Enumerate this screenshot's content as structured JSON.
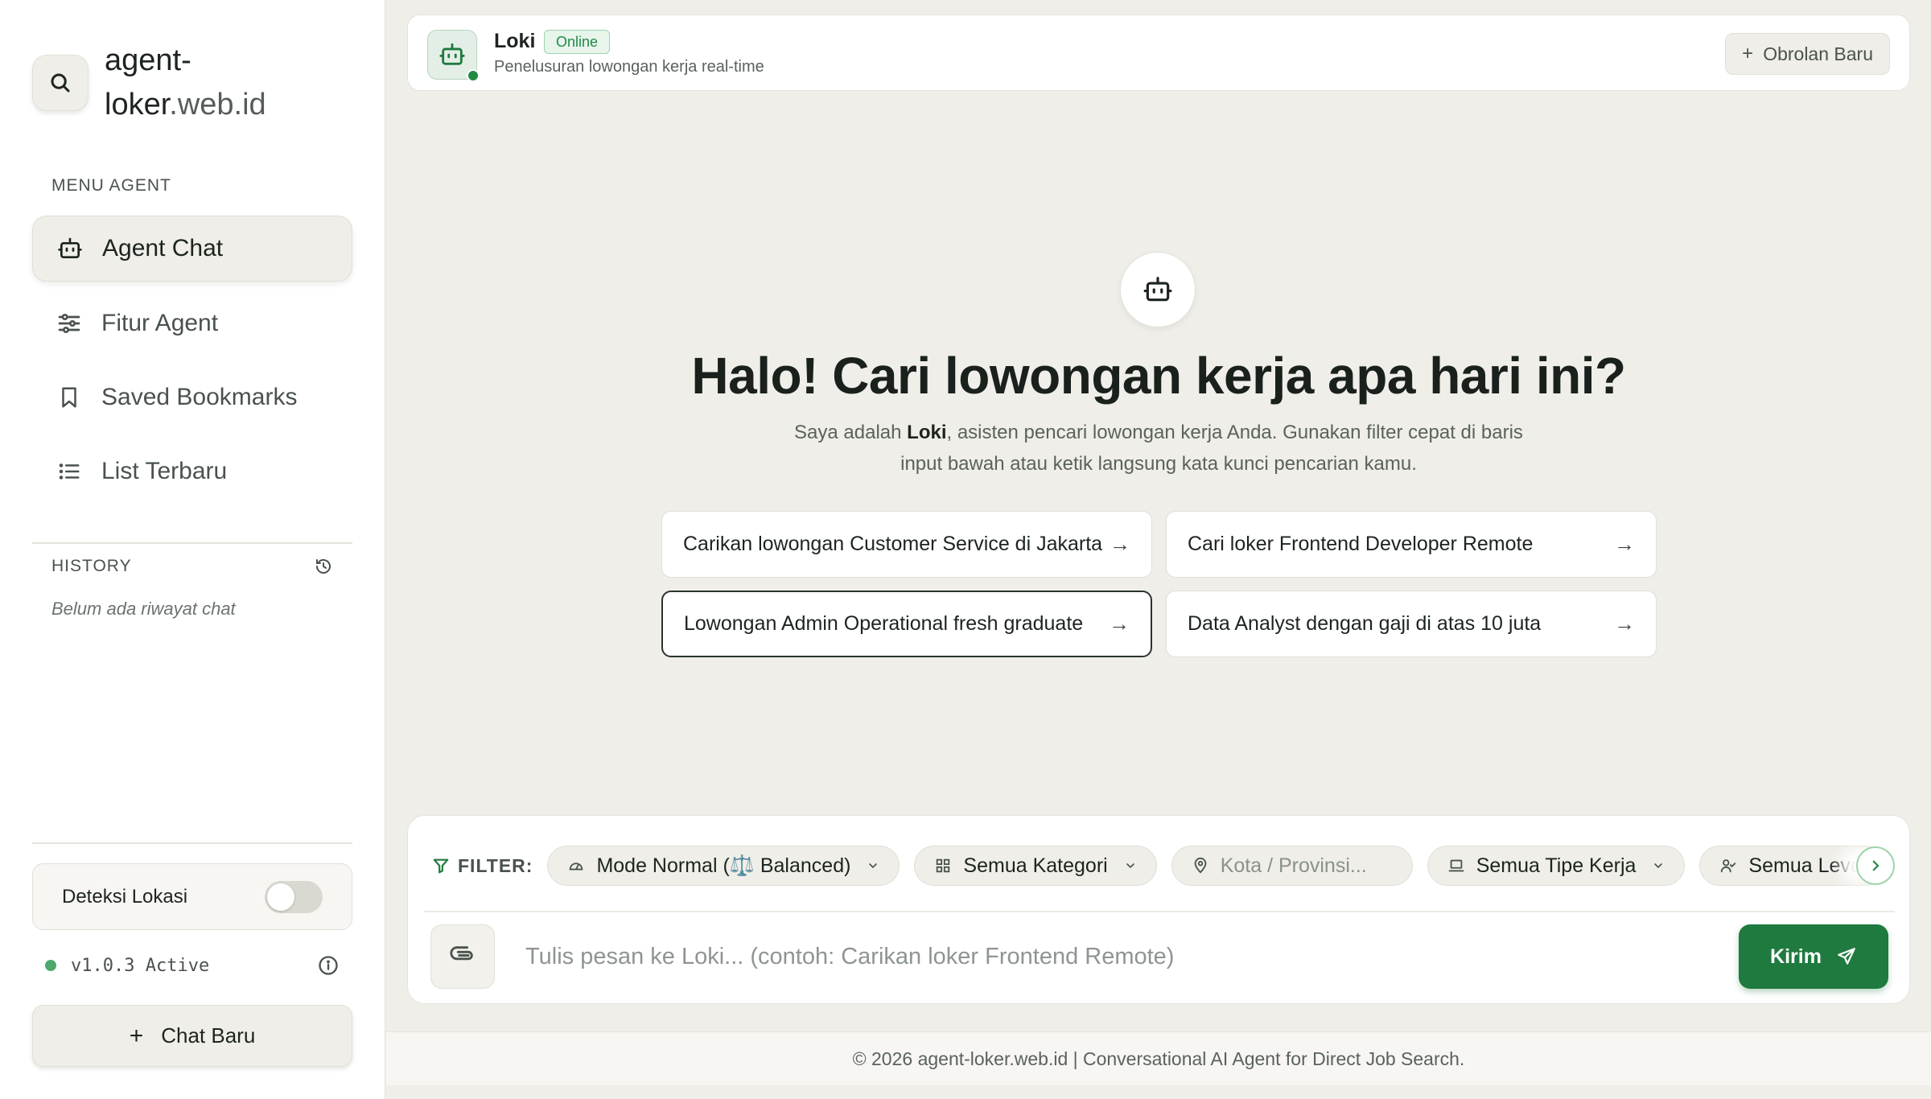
{
  "brand": {
    "name_main": "agent-loker",
    "name_suffix": ".web.id",
    "logo_icon": "search-icon"
  },
  "sidebar": {
    "menu_label": "MENU AGENT",
    "items": [
      {
        "label": "Agent Chat",
        "icon": "robot-icon",
        "active": true
      },
      {
        "label": "Fitur Agent",
        "icon": "sliders-icon",
        "active": false
      },
      {
        "label": "Saved Bookmarks",
        "icon": "bookmark-icon",
        "active": false
      },
      {
        "label": "List Terbaru",
        "icon": "list-icon",
        "active": false
      }
    ],
    "history_label": "HISTORY",
    "history_empty": "Belum ada riwayat chat",
    "geo_label": "Deteksi Lokasi",
    "geo_enabled": false,
    "version": "v1.0.3 Active",
    "new_chat": "Chat Baru"
  },
  "header": {
    "agent_name": "Loki",
    "status": "Online",
    "subtitle": "Penelusuran lowongan kerja real-time",
    "new_conversation": "Obrolan Baru"
  },
  "hero": {
    "title": "Halo! Cari lowongan kerja apa hari ini?",
    "desc_prefix": "Saya adalah ",
    "desc_name": "Loki",
    "desc_suffix": ", asisten pencari lowongan kerja Anda. Gunakan filter cepat di baris input bawah atau ketik langsung kata kunci pencarian kamu.",
    "suggestions": [
      "Carikan lowongan Customer Service di Jakarta",
      "Cari loker Frontend Developer Remote",
      "Lowongan Admin Operational fresh graduate",
      "Data Analyst dengan gaji di atas 10 juta"
    ]
  },
  "filters": {
    "label": "FILTER:",
    "mode": "Mode Normal (⚖️ Balanced)",
    "category": "Semua Kategori",
    "location_placeholder": "Kota / Provinsi...",
    "work_type": "Semua Tipe Kerja",
    "level": "Semua Level"
  },
  "composer": {
    "placeholder": "Tulis pesan ke Loki... (contoh: Carikan loker Frontend Remote)",
    "send": "Kirim"
  },
  "footer": {
    "text": "© 2026 agent-loker.web.id | Conversational AI Agent for Direct Job Search."
  },
  "colors": {
    "accent": "#1f7a3f",
    "online": "#1f8a45",
    "background": "#efeee8"
  }
}
